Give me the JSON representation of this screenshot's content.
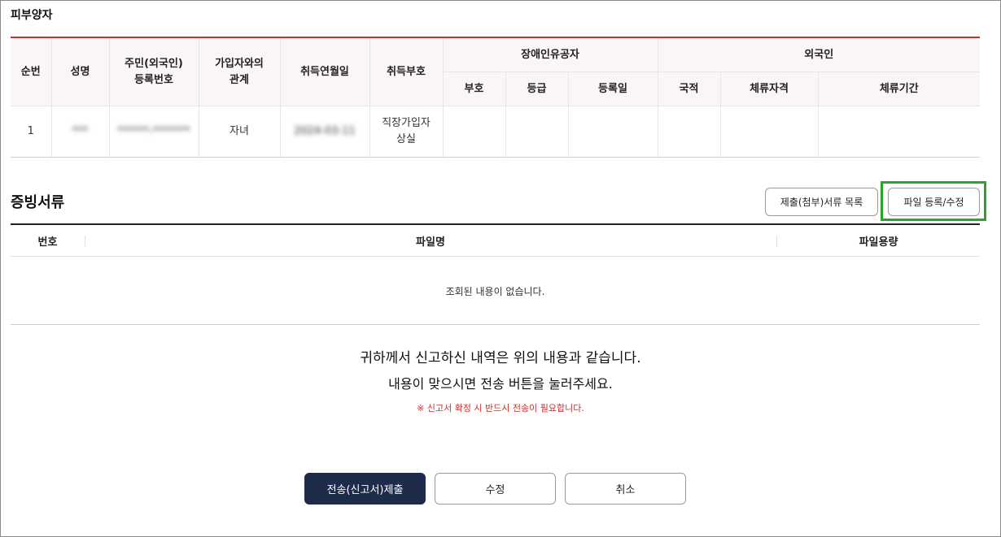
{
  "dependents": {
    "title": "피부양자",
    "headers": {
      "seq": "순번",
      "name": "성명",
      "rrn": "주민(외국인)\n등록번호",
      "relation": "가입자와의\n관계",
      "acquire_date": "취득연월일",
      "acquire_code": "취득부호",
      "disabled_group": "장애인유공자",
      "disabled_code": "부호",
      "disabled_grade": "등급",
      "disabled_reg_date": "등록일",
      "foreigner_group": "외국인",
      "nationality": "국적",
      "stay_status": "체류자격",
      "stay_period": "체류기간"
    },
    "rows": [
      {
        "seq": "1",
        "name": "***",
        "rrn": "******-*******",
        "relation": "자녀",
        "acquire_date": "2024-03-11",
        "acquire_code": "직장가입자\n상실",
        "disabled_code": "",
        "disabled_grade": "",
        "disabled_reg_date": "",
        "nationality": "",
        "stay_status": "",
        "stay_period": ""
      }
    ]
  },
  "documents": {
    "title": "증빙서류",
    "list_button": "제출(첨부)서류 목록",
    "upload_button": "파일 등록/수정",
    "headers": {
      "no": "번호",
      "filename": "파일명",
      "size": "파일용량"
    },
    "empty_message": "조회된 내용이 없습니다."
  },
  "confirm": {
    "line1": "귀하께서 신고하신 내역은 위의 내용과 같습니다.",
    "line2": "내용이 맞으시면 전송 버튼을 눌러주세요.",
    "warning": "※ 신고서 확정 시 반드시 전송이 필요합니다."
  },
  "actions": {
    "submit": "전송(신고서)제출",
    "edit": "수정",
    "cancel": "취소"
  },
  "colors": {
    "accent_red": "#c9302c",
    "primary_navy": "#1f2b4a",
    "highlight_green": "#2aa52a"
  }
}
